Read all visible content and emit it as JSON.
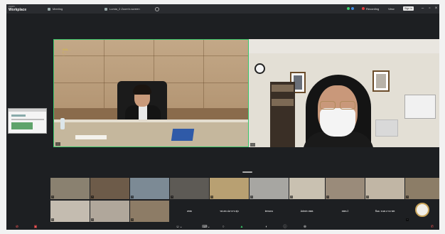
{
  "titlebar": {
    "brand_line1": "zoom",
    "brand_line2": "Workplace",
    "tabs": [
      {
        "label": "Meeting"
      },
      {
        "label": "Lumia_2 Zoom's screen"
      }
    ],
    "recording_label": "Recording",
    "view_label": "View",
    "sign_in_label": "Sign in",
    "status_colors": [
      "#3ad06b",
      "#3a8be0",
      "#e23b3b"
    ]
  },
  "stage": {
    "tile_a": {
      "sign_lines": [
        "HEAL ...",
        "1 ...",
        "..."
      ],
      "name": "..."
    },
    "tile_b": {
      "name": "..."
    }
  },
  "gallery": {
    "row1": [
      {
        "name": "..."
      },
      {
        "name": "..."
      },
      {
        "name": "..."
      },
      {
        "name": "..."
      },
      {
        "name": "..."
      },
      {
        "name": "..."
      },
      {
        "name": "..."
      },
      {
        "name": "..."
      },
      {
        "name": "..."
      },
      {
        "name": "..."
      }
    ],
    "row2_named": [
      {
        "name": "..."
      },
      {
        "name": "..."
      },
      {
        "name": "..."
      }
    ],
    "row2_text": [
      "สพท",
      "รพ.สต.ปลากระทุ่ง",
      "lemono",
      "Admin สพพ.",
      "สพท.2",
      "ป้อม จนท.ภาค พท"
    ],
    "row2_last_name": "..."
  },
  "controls": {
    "mic_icon": "mic-muted-icon",
    "video_icon": "video-off-icon",
    "participants_icon": "participants-icon",
    "chat_icon": "chat-icon",
    "share_icon": "share-screen-icon",
    "record_icon": "record-icon",
    "reactions_icon": "reactions-icon",
    "info_icon": "info-icon",
    "apps_icon": "apps-icon",
    "end_icon": "end-icon",
    "accent_green": "#3ad06b",
    "accent_red": "#ff5555"
  }
}
